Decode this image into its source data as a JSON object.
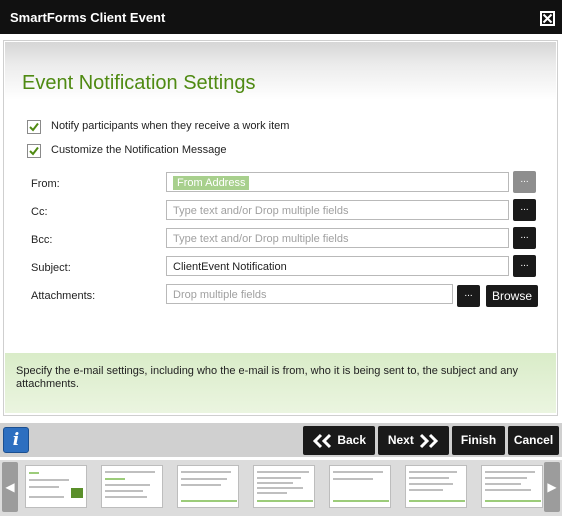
{
  "window": {
    "title": "SmartForms Client Event"
  },
  "page": {
    "heading": "Event Notification Settings"
  },
  "options": [
    {
      "label": "Notify participants when they receive a work item",
      "checked": true
    },
    {
      "label": "Customize the Notification Message",
      "checked": true
    }
  ],
  "fields": {
    "from": {
      "label": "From:",
      "token": "From Address",
      "button": "..."
    },
    "cc": {
      "label": "Cc:",
      "placeholder": "Type text and/or Drop multiple fields",
      "button": "..."
    },
    "bcc": {
      "label": "Bcc:",
      "placeholder": "Type text and/or Drop multiple fields",
      "button": "..."
    },
    "subject": {
      "label": "Subject:",
      "value": "ClientEvent Notification",
      "button": "..."
    },
    "attachments": {
      "label": "Attachments:",
      "placeholder": "Drop multiple fields",
      "button": "...",
      "browse": "Browse"
    }
  },
  "help": {
    "text": "Specify the e-mail settings, including who the e-mail is from, who it is being sent to, the subject and any attachments."
  },
  "footer": {
    "info": "i",
    "back": "Back",
    "next": "Next",
    "finish": "Finish",
    "cancel": "Cancel"
  },
  "colors": {
    "accent_green": "#4f8a12",
    "help_bg": "#d9ecc8",
    "titlebar": "#111111",
    "token": "#a8d08d"
  }
}
